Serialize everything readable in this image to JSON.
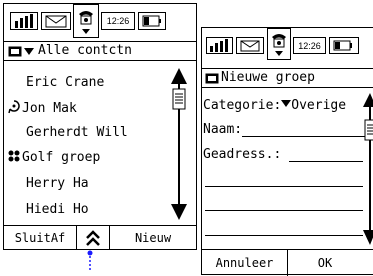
{
  "phone1": {
    "status": {
      "time": "12:26",
      "icons": [
        "signal-icon",
        "mail-icon",
        "phone-icon",
        "battery-icon"
      ]
    },
    "title": "Alle contctn",
    "contacts": [
      {
        "name": "Eric Crane",
        "icon": ""
      },
      {
        "name": "Jon Mak",
        "icon": "presence-icon"
      },
      {
        "name": "Gerherdt Will",
        "icon": ""
      },
      {
        "name": "Golf groep",
        "icon": "group-icon"
      },
      {
        "name": "Herry Ha",
        "icon": ""
      },
      {
        "name": "Hiedi Ho",
        "icon": ""
      }
    ],
    "softkeys": {
      "left": "SluitAf",
      "right": "Nieuw"
    }
  },
  "phone2": {
    "status": {
      "time": "12:26",
      "icons": [
        "signal-icon",
        "mail-icon",
        "phone-icon",
        "battery-icon"
      ]
    },
    "title": "Nieuwe groep",
    "category_label": "Categorie:",
    "category_value": "Overige",
    "name_label": "Naam:",
    "address_label": "Geadress.:",
    "softkeys": {
      "left": "Annuleer",
      "right": "OK"
    }
  },
  "colors": {
    "indicator": "#1a1aff"
  }
}
